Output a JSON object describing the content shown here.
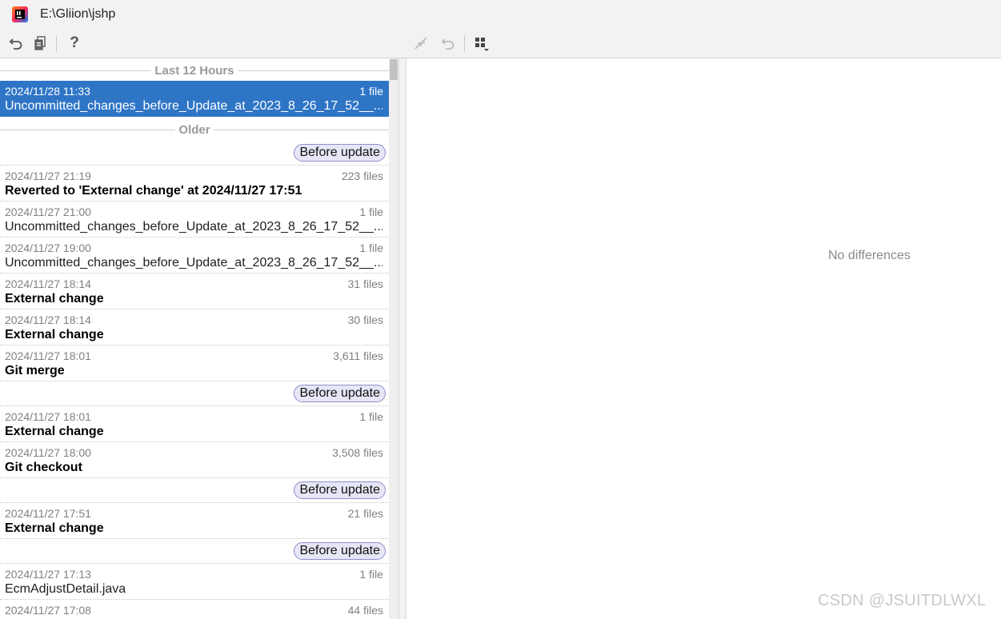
{
  "window": {
    "title": "E:\\Gliion\\jshp"
  },
  "toolbar": {
    "revert_icon": "undo-arrow-icon",
    "create_patch_icon": "patch-file-icon",
    "help_label": "?",
    "apply_icon": "merge-arrows-icon",
    "revert_change_icon": "undo-arrow-icon",
    "layout_icon": "grid-dropdown-icon"
  },
  "history": {
    "groups": [
      {
        "label": "Last 12 Hours"
      },
      {
        "label": "Older"
      }
    ],
    "selected_entry": {
      "timestamp": "2024/11/28 11:33",
      "files": "1 file",
      "label": "Uncommitted_changes_before_Update_at_2023_8_26_17_52__..."
    },
    "tag_label": "Before update",
    "entries": [
      {
        "timestamp": "2024/11/27 21:19",
        "files": "223 files",
        "label": "Reverted to 'External change' at 2024/11/27 17:51"
      },
      {
        "timestamp": "2024/11/27 21:00",
        "files": "1 file",
        "label": "Uncommitted_changes_before_Update_at_2023_8_26_17_52__..."
      },
      {
        "timestamp": "2024/11/27 19:00",
        "files": "1 file",
        "label": "Uncommitted_changes_before_Update_at_2023_8_26_17_52__..."
      },
      {
        "timestamp": "2024/11/27 18:14",
        "files": "31 files",
        "label": "External change"
      },
      {
        "timestamp": "2024/11/27 18:14",
        "files": "30 files",
        "label": "External change"
      },
      {
        "timestamp": "2024/11/27 18:01",
        "files": "3,611 files",
        "label": "Git merge"
      },
      {
        "timestamp": "2024/11/27 18:01",
        "files": "1 file",
        "label": "External change"
      },
      {
        "timestamp": "2024/11/27 18:00",
        "files": "3,508 files",
        "label": "Git checkout"
      },
      {
        "timestamp": "2024/11/27 17:51",
        "files": "21 files",
        "label": "External change"
      },
      {
        "timestamp": "2024/11/27 17:13",
        "files": "1 file",
        "label": "EcmAdjustDetail.java"
      },
      {
        "timestamp": "2024/11/27 17:08",
        "files": "44 files",
        "label": ""
      }
    ]
  },
  "diff": {
    "empty_message": "No differences"
  },
  "watermark": "CSDN @JSUITDLWXL"
}
